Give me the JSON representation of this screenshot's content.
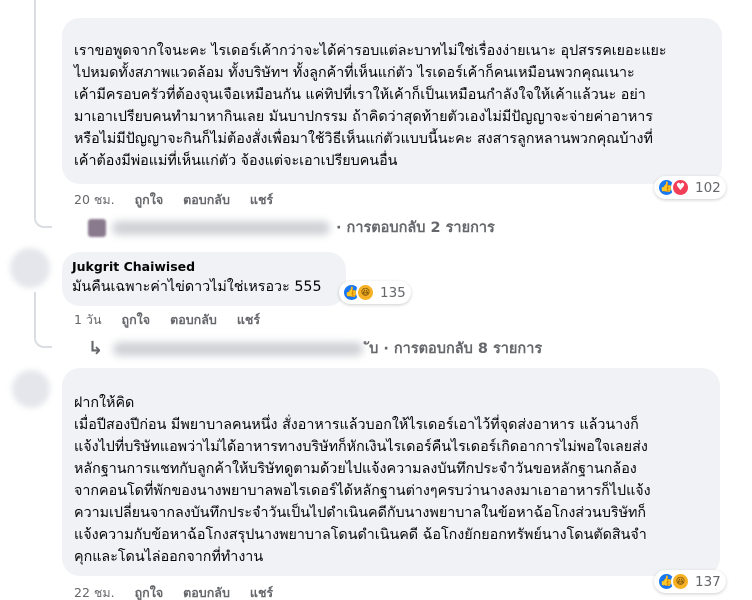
{
  "comments": [
    {
      "text": "เราขอพูดจากใจนะคะ ไรเดอร์เค้ากว่าจะได้ค่ารอบแต่ละบาทไม่ใช่เรื่องง่ายเนาะ อุปสรรคเยอะแยะ\nไปหมดทั้งสภาพแวดล้อม ทั้งบริษัทฯ ทั้งลูกค้าที่เห็นแก่ตัว ไรเดอร์เค้าก็คนเหมือนพวกคุณเนาะ\nเค้ามีครอบครัวที่ต้องจุนเจือเหมือนกัน แค่ทิปที่เราให้เค้าก็เป็นเหมือนกำลังใจให้เค้าแล้วนะ อย่า\nมาเอาเปรียบคนทำมาหากินเลย มันบาปกรรม ถ้าคิดว่าสุดท้ายตัวเองไม่มีปัญญาจะจ่ายค่าอาหาร\nหรือไม่มีปัญญาจะกินก็ไม่ต้องสั่งเพื่อมาใช้วิธีเห็นแก่ตัวแบบนี้นะคะ สงสารลูกหลานพวกคุณบ้างที่\nเค้าต้องมีพ่อแม่ที่เห็นแก่ตัว จ้องแต่จะเอาเปรียบคนอื่น",
      "time": "20 ชม.",
      "like": "ถูกใจ",
      "reply": "ตอบกลับ",
      "share": "แชร์",
      "reaction_count": "102",
      "replies_label": "· การตอบกลับ 2 รายการ"
    },
    {
      "name": "Jukgrit Chaiwised",
      "text": "มันคืนเฉพาะค่าไข่ดาวไม่ใช่เหรอวะ 555",
      "time": "1 วัน",
      "like": "ถูกใจ",
      "reply": "ตอบกลับ",
      "share": "แชร์",
      "reaction_count": "135",
      "replies_label": "ับ · การตอบกลับ 8 รายการ"
    },
    {
      "text": "ฝากให้คิด\nเมื่อปีสองปีก่อน มีพยาบาลคนหนึ่ง สั่งอาหารแล้วบอกให้ไรเดอร์เอาไว้ที่จุดส่งอาหาร แล้วนางก็\nแจ้งไปที่บริษัทแอพว่าไม่ได้อาหารทางบริษัทก็หักเงินไรเดอร์คืนไรเดอร์เกิดอาการไม่พอใจเลยส่ง\nหลักฐานการแชทกับลูกค้าให้บริษัทดูตามด้วยไปแจ้งความลงบันทึกประจำวันขอหลักฐานกล้อง\nจากคอนโดที่พักของนางพยาบาลพอไรเดอร์ได้หลักฐานต่างๆครบว่านางลงมาเอาอาหารก็ไปแจ้ง\nความเปลี่ยนจากลงบันทึกประจำวันเป็นไปดำเนินคดีกับนางพยาบาลในข้อหาฉ้อโกงส่วนบริษัทก็\nแจ้งความกับข้อหาฉ้อโกงสรุปนางพยาบาลโดนดำเนินคดี ฉ้อโกงยักยอกทรัพย์นางโดนตัดสินจำ\nคุกและโดนไล่ออกจากที่ทำงาน",
      "time": "22 ชม.",
      "like": "ถูกใจ",
      "reply": "ตอบกลับ",
      "share": "แชร์",
      "reaction_count": "137"
    }
  ],
  "colors": {
    "like": "#1877f2",
    "love": "#f33e58",
    "haha": "#f7b125",
    "bubble": "#f0f2f5",
    "meta": "#65676b"
  },
  "icons": [
    "like-icon",
    "love-icon",
    "haha-icon",
    "reply-arrow-icon"
  ]
}
